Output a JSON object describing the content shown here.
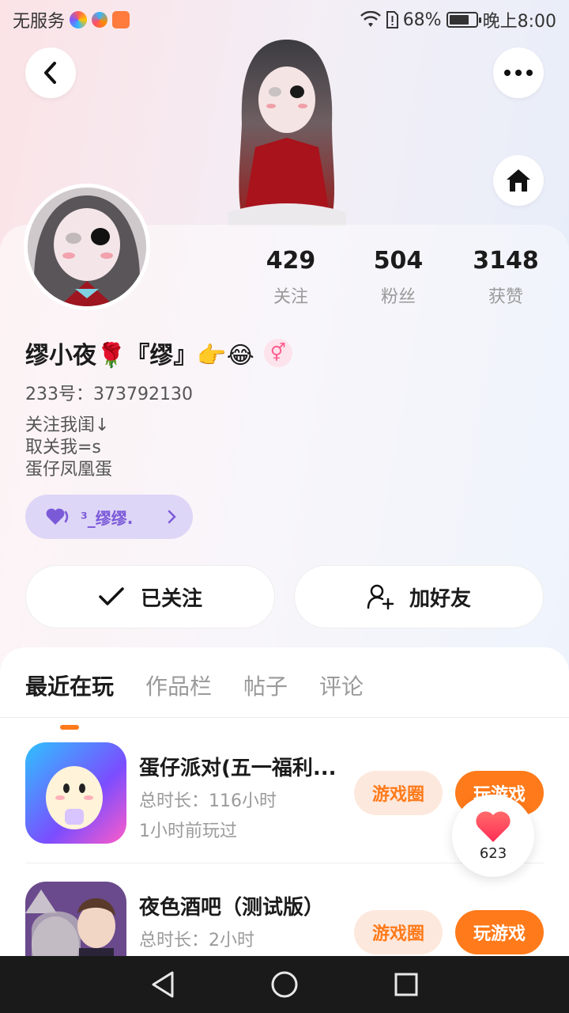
{
  "status_bar": {
    "carrier": "无服务",
    "battery": "68%",
    "time": "晚上8:00"
  },
  "profile": {
    "following_count": "429",
    "following_label": "关注",
    "fans_count": "504",
    "fans_label": "粉丝",
    "likes_count": "3148",
    "likes_label": "获赞",
    "nickname": "缪小夜🌹『缪』👉😂",
    "gender_symbol": "⚥",
    "user_id": "233号：373792130",
    "bio_lines": [
      "关注我闺↓",
      "取关我=s",
      "蛋仔凤凰蛋"
    ],
    "family_tag": "³_缪缪."
  },
  "actions": {
    "follow_label": "已关注",
    "add_friend_label": "加好友"
  },
  "tabs": [
    "最近在玩",
    "作品栏",
    "帖子",
    "评论"
  ],
  "games": [
    {
      "title": "蛋仔派对(五一福利...",
      "duration": "总时长：116小时",
      "last_played": "1小时前玩过",
      "circle_label": "游戏圈",
      "play_label": "玩游戏"
    },
    {
      "title": "夜色酒吧（测试版）",
      "duration": "总时长：2小时",
      "circle_label": "游戏圈",
      "play_label": "玩游戏"
    }
  ],
  "float_like": {
    "count": "623"
  },
  "colors": {
    "accent": "#ff7a1a",
    "family_tag_bg": "#ded6f7",
    "family_tag_text": "#7b5ad8"
  }
}
